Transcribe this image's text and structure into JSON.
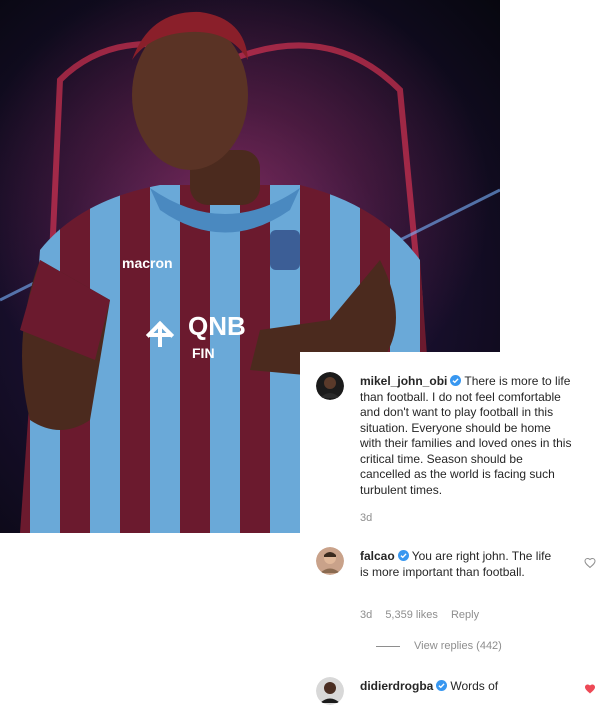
{
  "photo": {
    "jersey_brand": "macron",
    "sponsor": "QNB",
    "sponsor_sub": "FIN"
  },
  "comments": [
    {
      "username": "mikel_john_obi",
      "verified": true,
      "text": "There is more to life than football. I do not feel comfortable and don't want to play football in this situation. Everyone should be home with their families and loved ones in this critical time. Season should be cancelled as the world is facing such turbulent times.",
      "time": "3d"
    },
    {
      "username": "falcao",
      "verified": true,
      "text": "You are right john. The life is more important than football.",
      "time": "3d",
      "likes": "5,359 likes",
      "reply_label": "Reply",
      "view_replies": "View replies (442)"
    },
    {
      "username": "didierdrogba",
      "verified": true,
      "text": "Words of"
    }
  ],
  "colors": {
    "verified_blue": "#3897f0",
    "liked_red": "#ed4956",
    "muted_text": "#8e8e8e",
    "jersey_maroon": "#6b1a2e",
    "jersey_blue": "#6aa9d8"
  }
}
